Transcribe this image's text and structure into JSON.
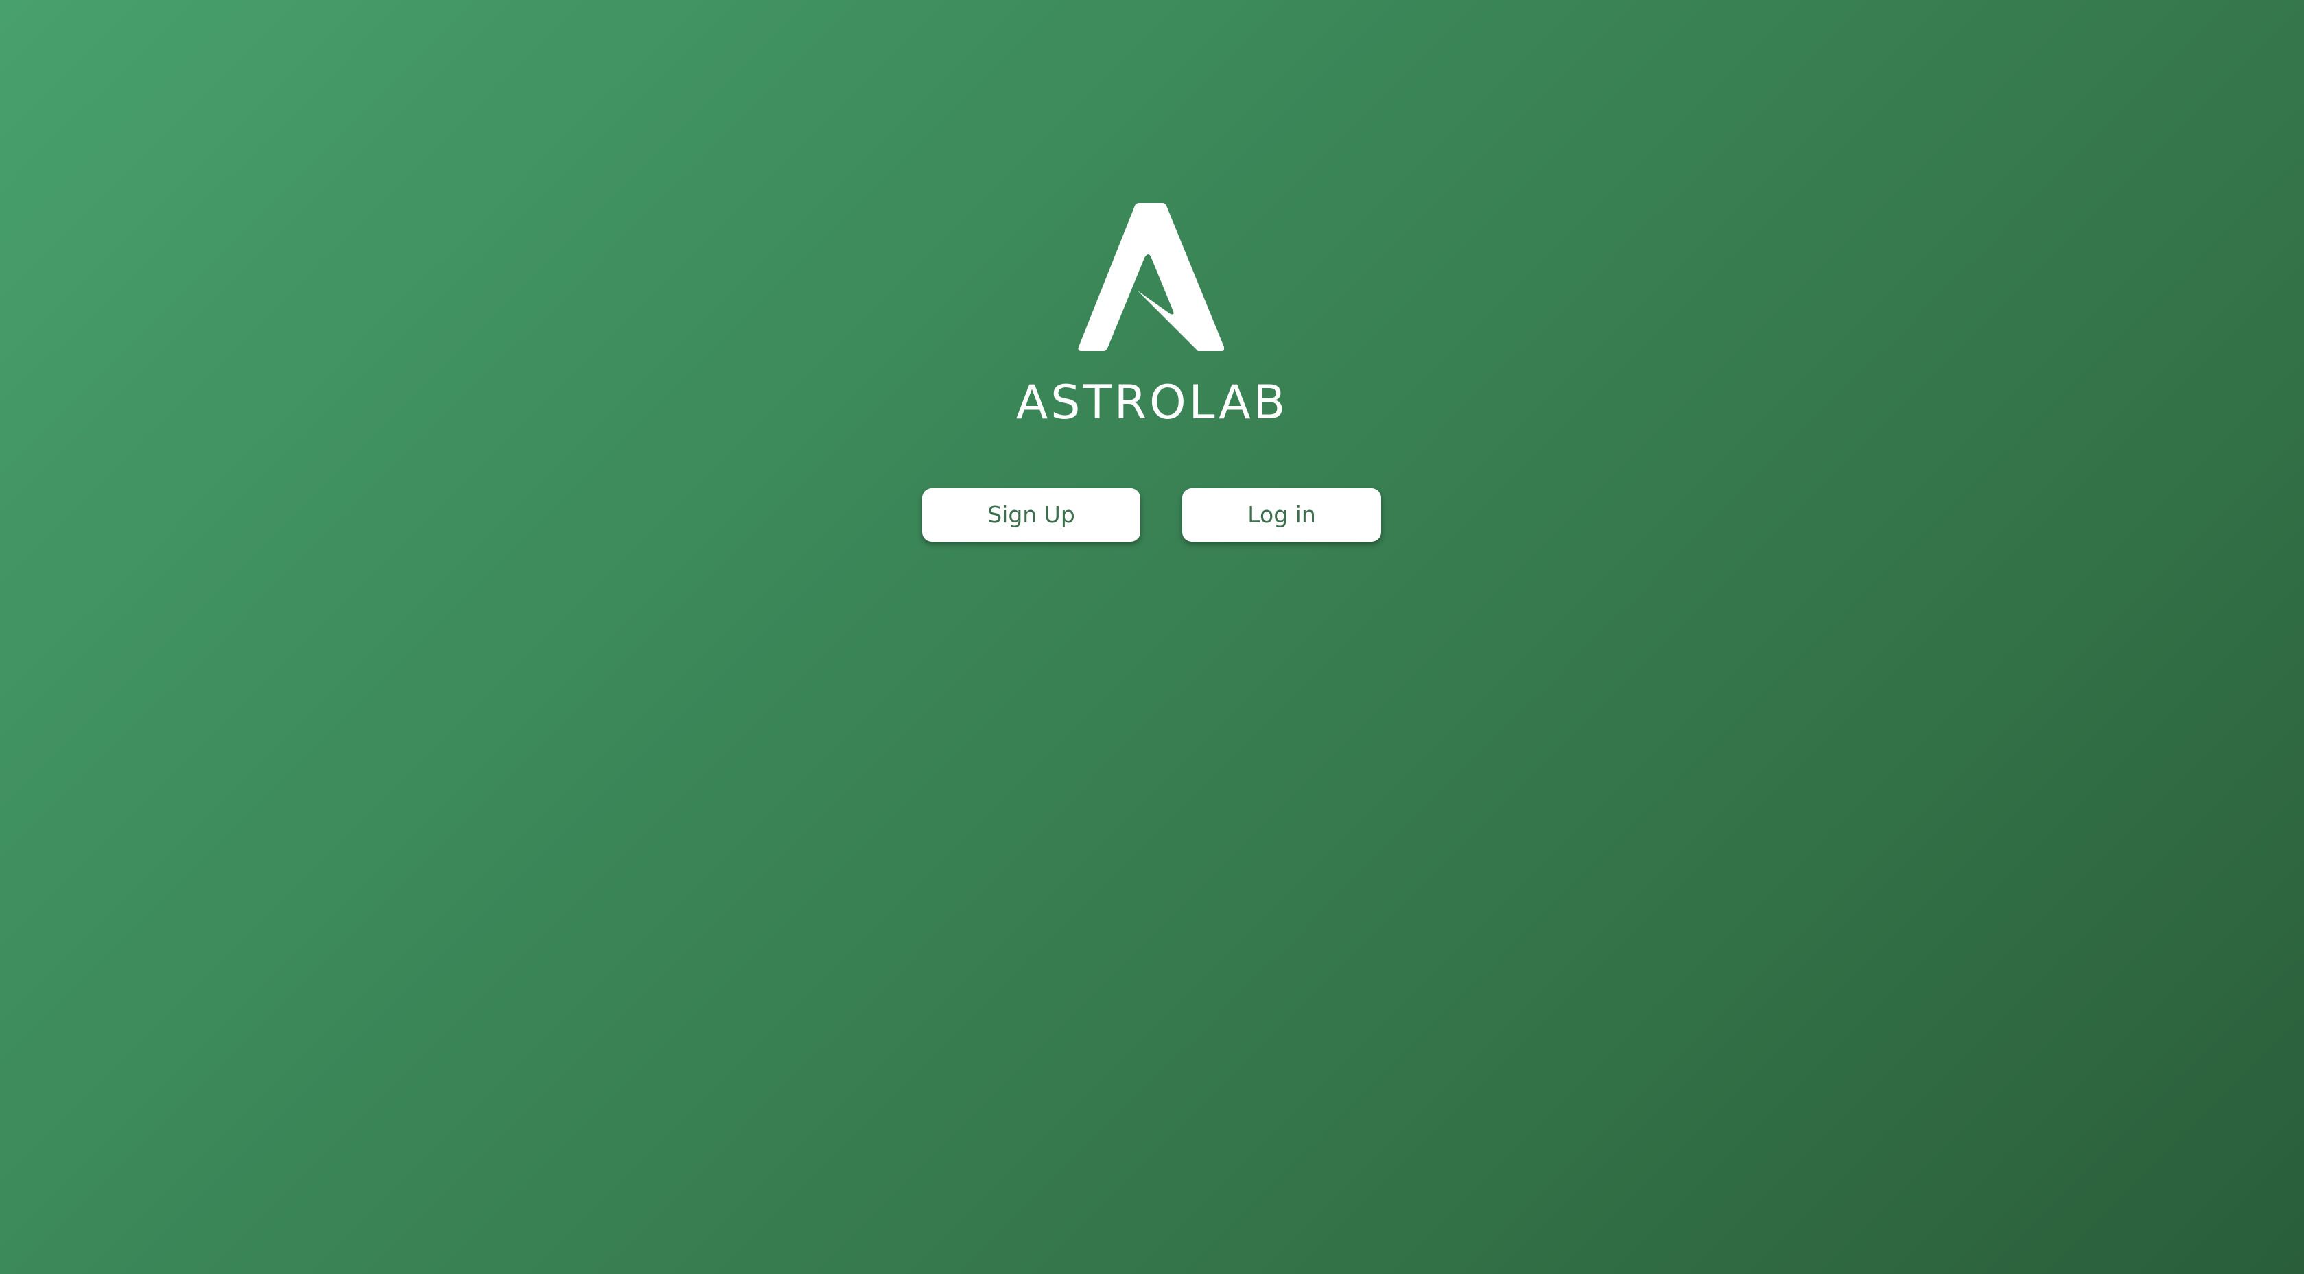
{
  "brand": {
    "name": "ASTROLAB",
    "logo_icon": "astrolab-a-logo-icon",
    "logo_color": "#ffffff"
  },
  "actions": {
    "signup_label": "Sign Up",
    "login_label": "Log in"
  },
  "theme": {
    "background_start": "#48a06c",
    "background_end": "#2a5e3b",
    "button_text_color": "#3d6e4d"
  }
}
